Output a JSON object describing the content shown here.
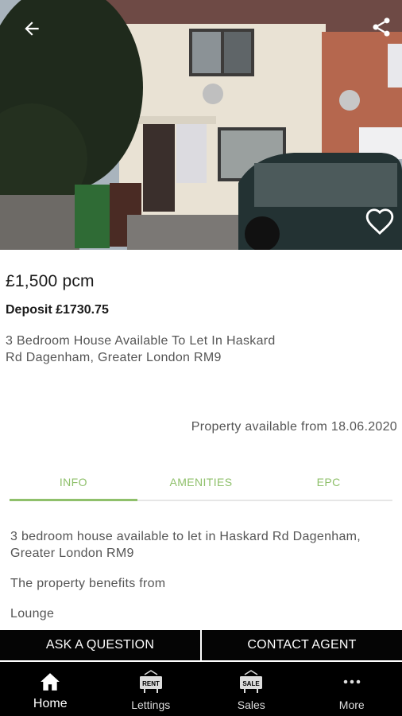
{
  "listing": {
    "price": "£1,500 pcm",
    "deposit": "Deposit £1730.75",
    "description": "3 Bedroom House Available To Let In Haskard Rd Dagenham, Greater London RM9",
    "available": "Property available from 18.06.2020"
  },
  "tabs": [
    {
      "label": "INFO",
      "active": true
    },
    {
      "label": "AMENITIES",
      "active": false
    },
    {
      "label": "EPC",
      "active": false
    }
  ],
  "info": {
    "paragraphs": [
      "3 bedroom house available to let in Haskard Rd Dagenham, Greater London RM9",
      "The property benefits from",
      "Lounge"
    ]
  },
  "actions": {
    "ask": "ASK A QUESTION",
    "contact": "CONTACT AGENT"
  },
  "nav": {
    "items": [
      {
        "label": "Home",
        "icon": "home-icon",
        "active": true
      },
      {
        "label": "Lettings",
        "icon": "rent-sign-icon",
        "badge": "RENT"
      },
      {
        "label": "Sales",
        "icon": "sale-sign-icon",
        "badge": "SALE"
      },
      {
        "label": "More",
        "icon": "more-dots-icon"
      }
    ]
  },
  "colors": {
    "accent": "#8fc06b",
    "bar": "#000000"
  }
}
